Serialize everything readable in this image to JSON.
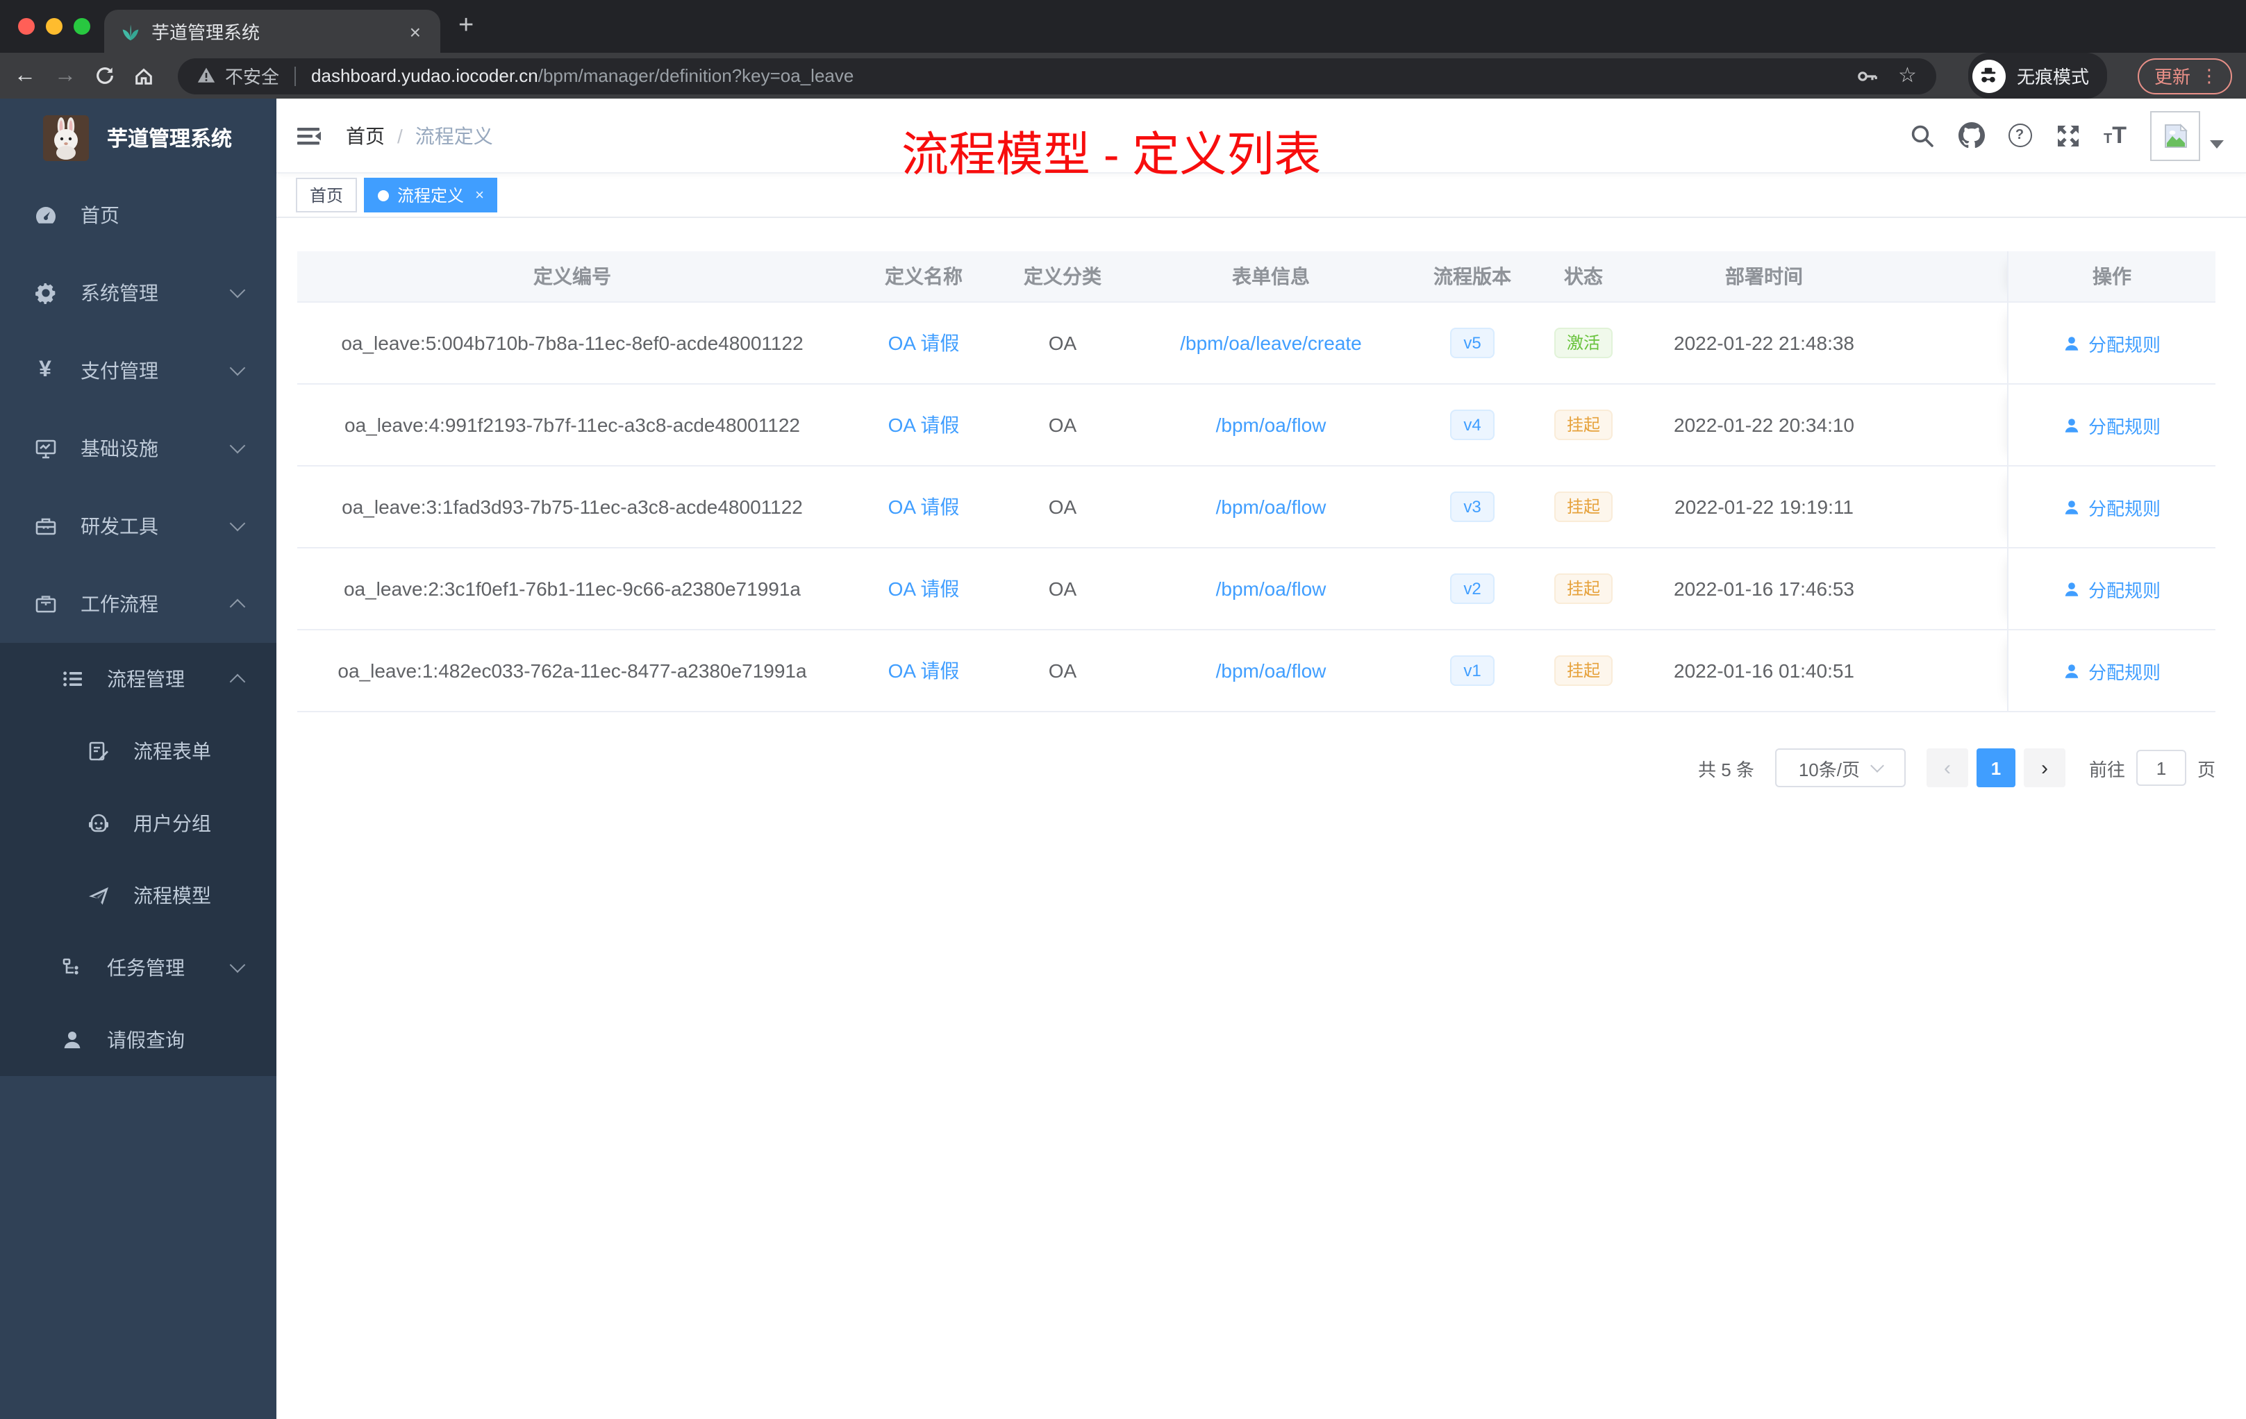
{
  "browser": {
    "tab_title": "芋道管理系统",
    "not_secure": "不安全",
    "url_host": "dashboard.yudao.iocoder.cn",
    "url_path": "/bpm/manager/definition?key=oa_leave",
    "incognito": "无痕模式",
    "update": "更新"
  },
  "icons": {
    "close": "×",
    "plus": "+",
    "back": "←",
    "forward": "→",
    "dots": "⋮",
    "star": "☆",
    "prev": "‹",
    "next": "›",
    "question": "?"
  },
  "sidebar": {
    "title": "芋道管理系统",
    "menu": [
      {
        "label": "首页"
      },
      {
        "label": "系统管理"
      },
      {
        "label": "支付管理"
      },
      {
        "label": "基础设施"
      },
      {
        "label": "研发工具"
      },
      {
        "label": "工作流程"
      },
      {
        "label": "流程管理"
      },
      {
        "label": "流程表单"
      },
      {
        "label": "用户分组"
      },
      {
        "label": "流程模型"
      },
      {
        "label": "任务管理"
      },
      {
        "label": "请假查询"
      }
    ]
  },
  "header": {
    "breadcrumb_home": "首页",
    "breadcrumb_sep": "/",
    "breadcrumb_current": "流程定义",
    "annotation": "流程模型 - 定义列表"
  },
  "tags": {
    "home": "首页",
    "active": "流程定义"
  },
  "table": {
    "columns": [
      "定义编号",
      "定义名称",
      "定义分类",
      "表单信息",
      "流程版本",
      "状态",
      "部署时间",
      "操作"
    ],
    "rows": [
      {
        "id": "oa_leave:5:004b710b-7b8a-11ec-8ef0-acde48001122",
        "name": "OA 请假",
        "category": "OA",
        "form": "/bpm/oa/leave/create",
        "version": "v5",
        "status": "激活",
        "time": "2022-01-22 21:48:38",
        "action": "分配规则"
      },
      {
        "id": "oa_leave:4:991f2193-7b7f-11ec-a3c8-acde48001122",
        "name": "OA 请假",
        "category": "OA",
        "form": "/bpm/oa/flow",
        "version": "v4",
        "status": "挂起",
        "time": "2022-01-22 20:34:10",
        "action": "分配规则"
      },
      {
        "id": "oa_leave:3:1fad3d93-7b75-11ec-a3c8-acde48001122",
        "name": "OA 请假",
        "category": "OA",
        "form": "/bpm/oa/flow",
        "version": "v3",
        "status": "挂起",
        "time": "2022-01-22 19:19:11",
        "action": "分配规则"
      },
      {
        "id": "oa_leave:2:3c1f0ef1-76b1-11ec-9c66-a2380e71991a",
        "name": "OA 请假",
        "category": "OA",
        "form": "/bpm/oa/flow",
        "version": "v2",
        "status": "挂起",
        "time": "2022-01-16 17:46:53",
        "action": "分配规则"
      },
      {
        "id": "oa_leave:1:482ec033-762a-11ec-8477-a2380e71991a",
        "name": "OA 请假",
        "category": "OA",
        "form": "/bpm/oa/flow",
        "version": "v1",
        "status": "挂起",
        "time": "2022-01-16 01:40:51",
        "action": "分配规则"
      }
    ]
  },
  "pagination": {
    "total": "共 5 条",
    "size": "10条/页",
    "page": "1",
    "goto_label": "前往",
    "goto_value": "1",
    "unit": "页"
  },
  "colors": {
    "accent": "#409eff",
    "success": "#67c23a",
    "warning": "#e6a23c",
    "annotation_red": "#f70d0d",
    "sidebar_bg": "#304156",
    "sidebar_sub_bg": "#263445"
  }
}
